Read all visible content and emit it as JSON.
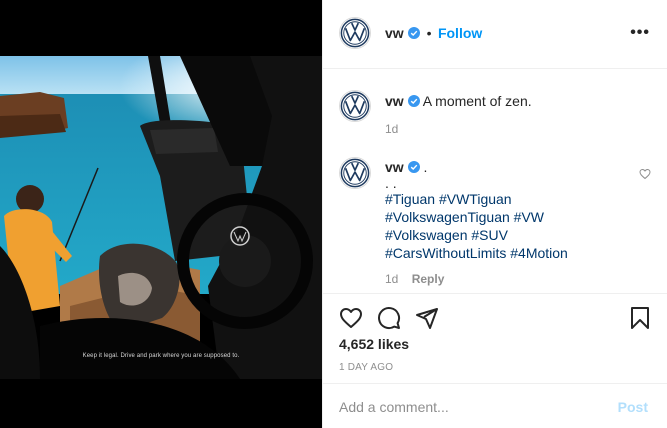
{
  "photo": {
    "caption": "Keep it legal. Drive and park where you are supposed to."
  },
  "header": {
    "username": "vw",
    "separator": "•",
    "follow_label": "Follow",
    "more_label": "•••"
  },
  "caption_comment": {
    "username": "vw",
    "text": "A moment of zen.",
    "time": "1d"
  },
  "hashtag_comment": {
    "username": "vw",
    "dot": ".",
    "dots": ". .",
    "tags_line1": "#Tiguan #VWTiguan",
    "tags_line2": "#VolkswagenTiguan #VW",
    "tags_line3": "#Volkswagen #SUV",
    "tags_line4": "#CarsWithoutLimits #4Motion",
    "time": "1d",
    "reply_label": "Reply"
  },
  "actions": {
    "likes": "4,652 likes",
    "date": "1 DAY AGO"
  },
  "add_comment": {
    "placeholder": "Add a comment...",
    "post_label": "Post"
  },
  "colors": {
    "accent": "#0095f6",
    "hashtag": "#00376b",
    "muted": "#8e8e8e",
    "post_disabled": "#b2dffc",
    "vw_blue": "#1e3a5f"
  },
  "icons": [
    "vw-logo-icon",
    "verified-badge-icon",
    "heart-icon",
    "comment-icon",
    "share-icon",
    "bookmark-icon",
    "more-icon"
  ]
}
